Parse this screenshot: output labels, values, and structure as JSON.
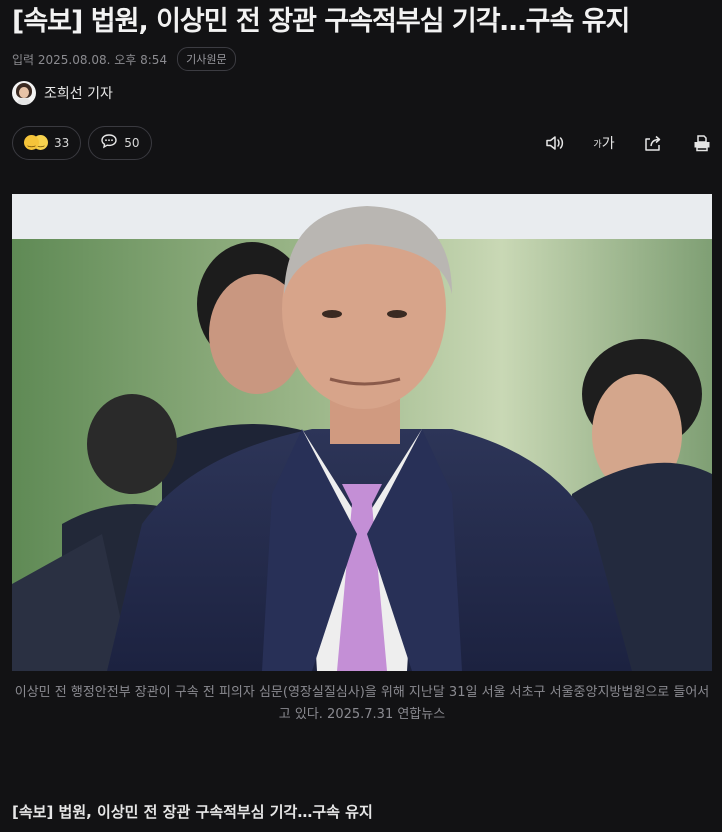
{
  "article": {
    "title": "[속보] 법원, 이상민 전 장관 구속적부심 기각…구속 유지",
    "date": "입력 2025.08.08. 오후 8:54",
    "original_link_label": "기사원문",
    "reporter": "조희선 기자"
  },
  "reactions": {
    "emoji_count": "33",
    "comment_count": "50"
  },
  "toolbar": {
    "font_size_label_small": "가",
    "font_size_label_big": "가"
  },
  "photo": {
    "caption": "이상민 전 행정안전부 장관이 구속 전 피의자 심문(영장실질심사)을 위해 지난달 31일 서울 서초구 서울중앙지방법원으로 들어서고 있다. 2025.7.31 연합뉴스"
  },
  "body": {
    "first_line": "[속보] 법원, 이상민 전 장관 구속적부심 기각…구속 유지"
  },
  "icons": [
    "emoji-reaction-icon",
    "comment-icon",
    "speaker-icon",
    "font-size-icon",
    "share-icon",
    "print-icon"
  ]
}
